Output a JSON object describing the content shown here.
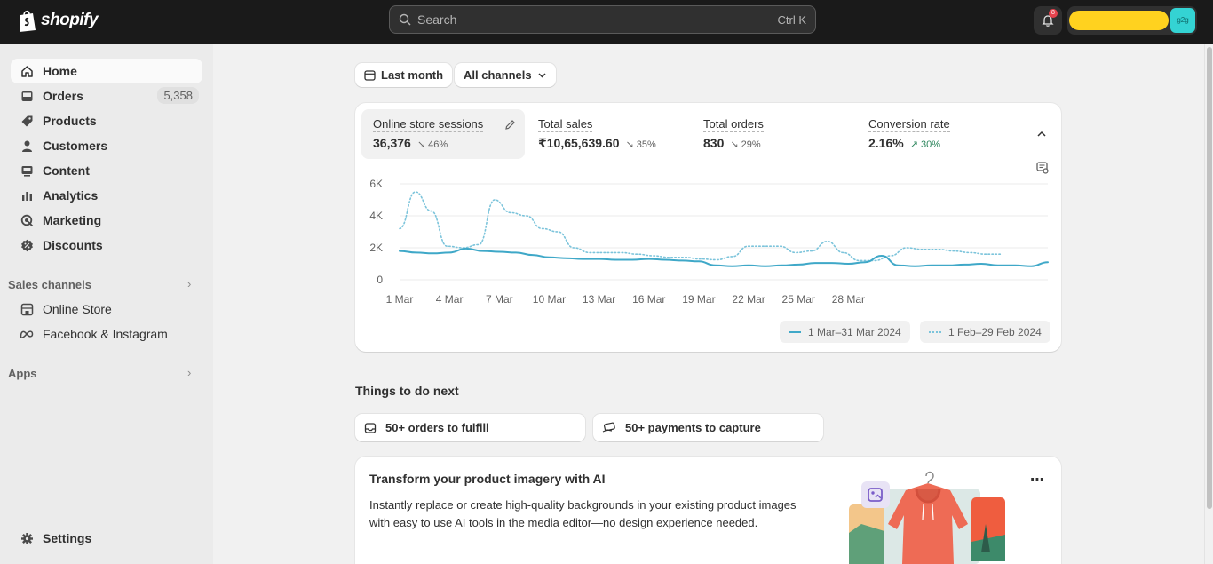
{
  "topbar": {
    "logo_text": "shopify",
    "search_placeholder": "Search",
    "search_shortcut": "Ctrl K",
    "notification_count": "8",
    "avatar_initials": "g2g"
  },
  "sidebar": {
    "items": [
      {
        "label": "Home",
        "icon": "home-icon",
        "active": true
      },
      {
        "label": "Orders",
        "icon": "inbox-icon",
        "count": "5,358"
      },
      {
        "label": "Products",
        "icon": "tag-icon"
      },
      {
        "label": "Customers",
        "icon": "person-icon"
      },
      {
        "label": "Content",
        "icon": "content-icon"
      },
      {
        "label": "Analytics",
        "icon": "bar-chart-icon"
      },
      {
        "label": "Marketing",
        "icon": "target-icon"
      },
      {
        "label": "Discounts",
        "icon": "discount-icon"
      }
    ],
    "sales_channels_label": "Sales channels",
    "channels": [
      {
        "label": "Online Store",
        "icon": "store-icon"
      },
      {
        "label": "Facebook & Instagram",
        "icon": "meta-icon"
      }
    ],
    "apps_label": "Apps",
    "settings_label": "Settings"
  },
  "filters": {
    "date_range": "Last month",
    "channels": "All channels"
  },
  "metrics": [
    {
      "label": "Online store sessions",
      "value": "36,376",
      "change": "46%",
      "direction": "down"
    },
    {
      "label": "Total sales",
      "value": "₹10,65,639.60",
      "change": "35%",
      "direction": "down"
    },
    {
      "label": "Total orders",
      "value": "830",
      "change": "29%",
      "direction": "down"
    },
    {
      "label": "Conversion rate",
      "value": "2.16%",
      "change": "30%",
      "direction": "up"
    }
  ],
  "chart_data": {
    "type": "line",
    "y_ticks": [
      "6K",
      "4K",
      "2K",
      "0"
    ],
    "ylim": [
      0,
      6000
    ],
    "x_ticks": [
      "1 Mar",
      "4 Mar",
      "7 Mar",
      "10 Mar",
      "13 Mar",
      "16 Mar",
      "19 Mar",
      "22 Mar",
      "25 Mar",
      "28 Mar"
    ],
    "series": [
      {
        "name": "1 Mar–31 Mar 2024",
        "style": "solid",
        "color": "#3fa8c8",
        "values": [
          1800,
          1700,
          1650,
          1700,
          1950,
          1800,
          1750,
          1700,
          1550,
          1400,
          1350,
          1300,
          1300,
          1250,
          1250,
          1300,
          1250,
          1200,
          1150,
          900,
          850,
          900,
          850,
          900,
          950,
          1050,
          1050,
          1000,
          1100,
          1500,
          900,
          850,
          900,
          900,
          950,
          1000,
          900,
          900,
          850,
          1100
        ]
      },
      {
        "name": "1 Feb–29 Feb 2024",
        "style": "dotted",
        "color": "#7cc4db",
        "values": [
          3200,
          5500,
          4300,
          2100,
          2000,
          2200,
          5000,
          4200,
          4000,
          3200,
          3000,
          2000,
          1700,
          1700,
          1700,
          1600,
          1500,
          1400,
          1400,
          1300,
          1250,
          1450,
          2100,
          2100,
          2100,
          1700,
          1800,
          2400,
          1700,
          1200,
          1200,
          1500,
          2000,
          1900,
          1900,
          1800,
          1700,
          1600,
          1600
        ]
      }
    ]
  },
  "things_to_do": {
    "title": "Things to do next",
    "tasks": [
      {
        "label": "50+ orders to fulfill",
        "icon": "inbox-icon"
      },
      {
        "label": "50+ payments to capture",
        "icon": "payment-icon"
      }
    ]
  },
  "promo": {
    "title": "Transform your product imagery with AI",
    "body": "Instantly replace or create high-quality backgrounds in your existing product images with easy to use AI tools in the media editor—no design experience needed."
  }
}
